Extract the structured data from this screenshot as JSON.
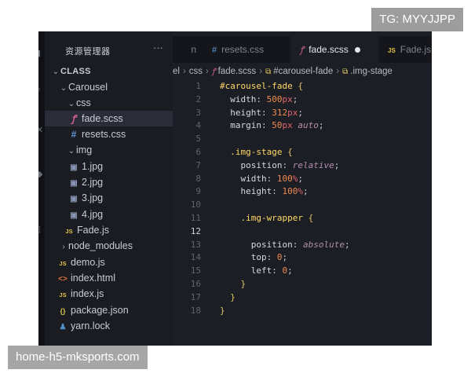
{
  "watermarks": {
    "top_right": "TG: MYYJJPP",
    "bottom_left": "home-h5-mksports.com"
  },
  "sidebar": {
    "title": "资源管理器",
    "more": "···",
    "tree": [
      {
        "label": "CLASS",
        "type": "folder-root",
        "expanded": true
      },
      {
        "label": "Carousel",
        "type": "folder",
        "expanded": true
      },
      {
        "label": "css",
        "type": "folder",
        "expanded": true
      },
      {
        "label": "fade.scss",
        "type": "scss",
        "selected": true
      },
      {
        "label": "resets.css",
        "type": "css"
      },
      {
        "label": "img",
        "type": "folder",
        "expanded": true
      },
      {
        "label": "1.jpg",
        "type": "image"
      },
      {
        "label": "2.jpg",
        "type": "image"
      },
      {
        "label": "3.jpg",
        "type": "image"
      },
      {
        "label": "4.jpg",
        "type": "image"
      },
      {
        "label": "Fade.js",
        "type": "js"
      },
      {
        "label": "node_modules",
        "type": "folder",
        "expanded": false
      },
      {
        "label": "demo.js",
        "type": "js"
      },
      {
        "label": "index.html",
        "type": "html"
      },
      {
        "label": "index.js",
        "type": "js"
      },
      {
        "label": "package.json",
        "type": "json"
      },
      {
        "label": "yarn.lock",
        "type": "yarn"
      }
    ]
  },
  "tabs": [
    {
      "label": "n",
      "icon": ""
    },
    {
      "label": "resets.css",
      "icon": "#"
    },
    {
      "label": "fade.scss",
      "icon": "scss-icon",
      "active": true,
      "modified": true
    },
    {
      "label": "Fade.js",
      "icon": "JS"
    }
  ],
  "breadcrumb": [
    "el",
    "css",
    "fade.scss",
    "#carousel-fade",
    ".img-stage"
  ],
  "code_lines": [
    {
      "n": "1",
      "text": "#carousel-fade {"
    },
    {
      "n": "2",
      "text": "  width: 500px;"
    },
    {
      "n": "3",
      "text": "  height: 312px;"
    },
    {
      "n": "4",
      "text": "  margin: 50px auto;"
    },
    {
      "n": "5",
      "text": ""
    },
    {
      "n": "6",
      "text": "  .img-stage {"
    },
    {
      "n": "7",
      "text": "    position: relative;"
    },
    {
      "n": "8",
      "text": "    width: 100%;"
    },
    {
      "n": "9",
      "text": "    height: 100%;"
    },
    {
      "n": "10",
      "text": ""
    },
    {
      "n": "11",
      "text": "    .img-wrapper {"
    },
    {
      "n": "12",
      "text": ""
    },
    {
      "n": "13",
      "text": "      position: absolute;"
    },
    {
      "n": "14",
      "text": "      top: 0;"
    },
    {
      "n": "15",
      "text": "      left: 0;"
    },
    {
      "n": "16",
      "text": "    }"
    },
    {
      "n": "17",
      "text": "  }"
    },
    {
      "n": "18",
      "text": "}"
    }
  ],
  "current_line": "12",
  "icons": {
    "folder_open": "chevron-down-icon",
    "folder_closed": "chevron-right-icon"
  }
}
